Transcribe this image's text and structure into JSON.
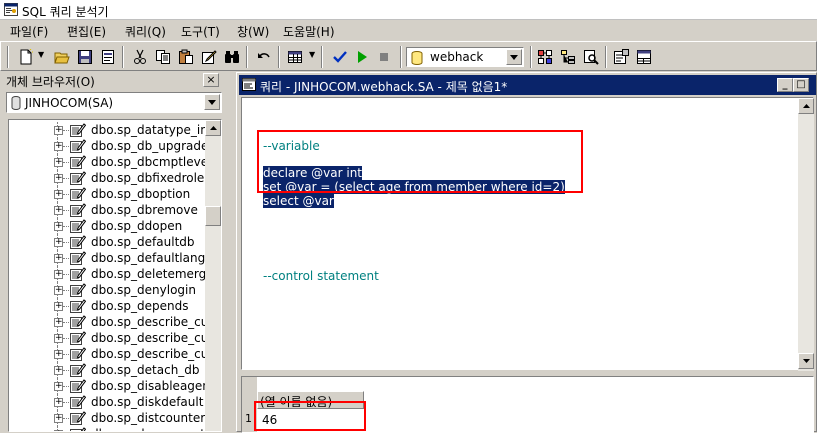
{
  "app": {
    "title": "SQL 쿼리 분석기"
  },
  "menu": [
    "파일(F)",
    "편집(E)",
    "쿼리(Q)",
    "도구(T)",
    "창(W)",
    "도움말(H)"
  ],
  "toolbar": {
    "buttons": [
      "new-query",
      "open",
      "save",
      "insert-template",
      "cut",
      "copy",
      "paste",
      "clear-window",
      "find",
      "undo",
      "results-mode",
      "parse",
      "execute",
      "cancel",
      "show-plan",
      "object-browser",
      "object-search",
      "current-connection-properties",
      "show-results-pane"
    ],
    "database": "webhack"
  },
  "object_browser": {
    "title": "개체 브라우저(O)",
    "close": "×",
    "server": "JINHOCOM(SA)",
    "tree_items": [
      "dbo.sp_datatype_inf",
      "dbo.sp_db_upgrade",
      "dbo.sp_dbcmptlevel",
      "dbo.sp_dbfixedrolep",
      "dbo.sp_dboption",
      "dbo.sp_dbremove",
      "dbo.sp_ddopen",
      "dbo.sp_defaultdb",
      "dbo.sp_defaultlangu",
      "dbo.sp_deletemerge",
      "dbo.sp_denylogin",
      "dbo.sp_depends",
      "dbo.sp_describe_cu",
      "dbo.sp_describe_cu",
      "dbo.sp_describe_cu",
      "dbo.sp_detach_db",
      "dbo.sp_disableagen",
      "dbo.sp_diskdefault",
      "dbo.sp_distcounters",
      "dbo.sp_drop_agent"
    ]
  },
  "query_window": {
    "title": "쿼리 - JINHOCOM.webhack.SA - 제목 없음1*",
    "buttons": {
      "minimize": "_",
      "maximize": "□",
      "close": "×"
    },
    "code": {
      "comment1": "--variable",
      "line1": "declare @var int",
      "line2": "set @var = (select age from member where id=2)",
      "line3": "select @var",
      "comment2": "--control statement"
    },
    "results": {
      "column_header": "(열 이름 없음)",
      "rows": [
        {
          "num": "1",
          "value": "46"
        }
      ]
    }
  }
}
